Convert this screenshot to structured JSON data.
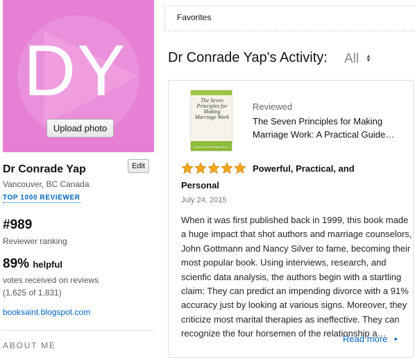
{
  "profile": {
    "initials": "DY",
    "avatar_color": "#e77fd5",
    "upload_label": "Upload photo",
    "name": "Dr Conrade Yap",
    "edit_label": "Edit",
    "location": "Vancouver, BC Canada",
    "badge": "TOP 1000 REVIEWER",
    "rank": "#989",
    "rank_label": "Reviewer ranking",
    "helpful_percent": "89%",
    "helpful_word": "helpful",
    "votes_label": "votes received on reviews",
    "votes_count": "(1,625 of 1,831)",
    "website": "booksaint.blogspot.com",
    "about_me_heading": "ABOUT ME"
  },
  "favorites": {
    "label": "Favorites"
  },
  "activity": {
    "title": "Dr Conrade Yap's Activity:",
    "filter_value": "All",
    "item": {
      "action": "Reviewed",
      "book_cover_text": "The Seven Principles for Making Marriage Work",
      "book_cover_author": "JOHN M. GOTTMAN, Ph.D.",
      "book_title": "The Seven Principles for Making Marriage Work: A Practical Guide…",
      "rating_stars": 5,
      "star_color": "#f7a81a",
      "headline_line1": "Powerful, Practical, and",
      "headline_line2": "Personal",
      "date": "July 24, 2015",
      "body": "When it was first published back in 1999, this book made a huge impact that shot authors and marriage counselors, John Gottmann and Nancy Silver to fame, becoming their most popular book. Using interviews, research, and scienfic data analysis, the authors begin with a startling claim: They can predict an impending divorce with a 91% accuracy just by looking at various signs. Moreover, they criticize most marital therapies as ineffective. They can recognize the four horsemen of the relationship a…",
      "read_more": "Read more"
    }
  },
  "colors": {
    "link": "#0066c0",
    "accent_green": "#8dbb3b"
  }
}
